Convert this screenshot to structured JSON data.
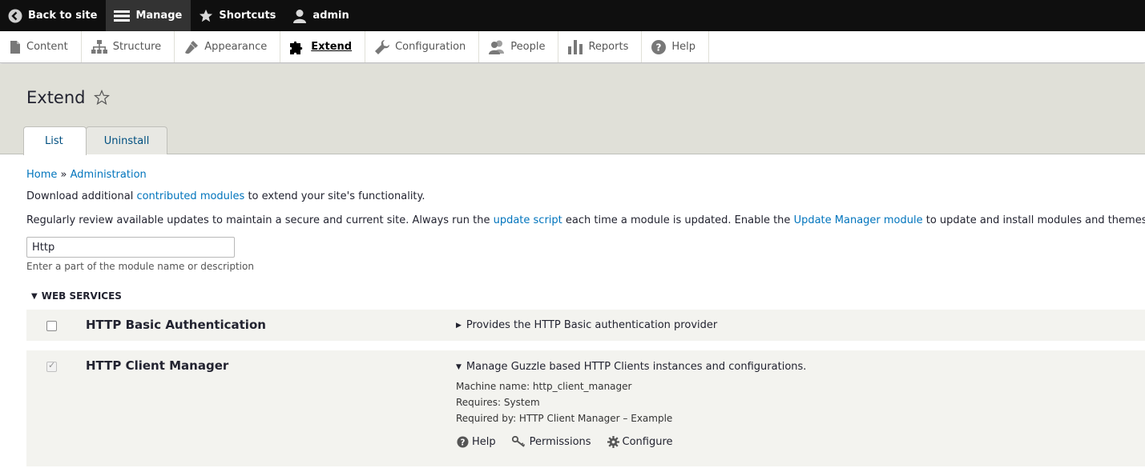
{
  "toolbar": {
    "back_label": "Back to site",
    "manage_label": "Manage",
    "shortcuts_label": "Shortcuts",
    "user_label": "admin"
  },
  "tray": {
    "items": [
      {
        "label": "Content",
        "icon": "file-icon"
      },
      {
        "label": "Structure",
        "icon": "sitemap-icon"
      },
      {
        "label": "Appearance",
        "icon": "paintbrush-icon"
      },
      {
        "label": "Extend",
        "icon": "puzzle-icon",
        "active": true
      },
      {
        "label": "Configuration",
        "icon": "wrench-icon"
      },
      {
        "label": "People",
        "icon": "people-icon"
      },
      {
        "label": "Reports",
        "icon": "bar-chart-icon"
      },
      {
        "label": "Help",
        "icon": "help-icon"
      }
    ]
  },
  "header": {
    "title": "Extend",
    "tabs": [
      {
        "label": "List",
        "active": true
      },
      {
        "label": "Uninstall",
        "active": false
      }
    ]
  },
  "breadcrumb": {
    "home": "Home",
    "separator": "»",
    "admin": "Administration"
  },
  "intro": {
    "line1_before": "Download additional ",
    "line1_link": "contributed modules",
    "line1_after": " to extend your site's functionality.",
    "line2_before": "Regularly review available updates to maintain a secure and current site. Always run the ",
    "line2_link1": "update script",
    "line2_middle": " each time a module is updated. Enable the ",
    "line2_link2": "Update Manager module",
    "line2_after": " to update and install modules and themes."
  },
  "filter": {
    "value": "Http",
    "description": "Enter a part of the module name or description"
  },
  "group": {
    "title": "WEB SERVICES"
  },
  "modules": [
    {
      "name": "HTTP Basic Authentication",
      "description": "Provides the HTTP Basic authentication provider",
      "checked": false
    },
    {
      "name": "HTTP Client Manager",
      "description": "Manage Guzzle based HTTP Clients instances and configurations.",
      "checked": true,
      "machine_name": "Machine name: http_client_manager",
      "requires": "Requires: System",
      "required_by": "Required by: HTTP Client Manager – Example",
      "help_label": "Help",
      "permissions_label": "Permissions",
      "configure_label": "Configure"
    }
  ],
  "colors": {
    "toolbar_bg": "#0f0f0f",
    "header_bg": "#e0e0d8",
    "link": "#0074bd",
    "row_bg": "#f3f3ef"
  }
}
